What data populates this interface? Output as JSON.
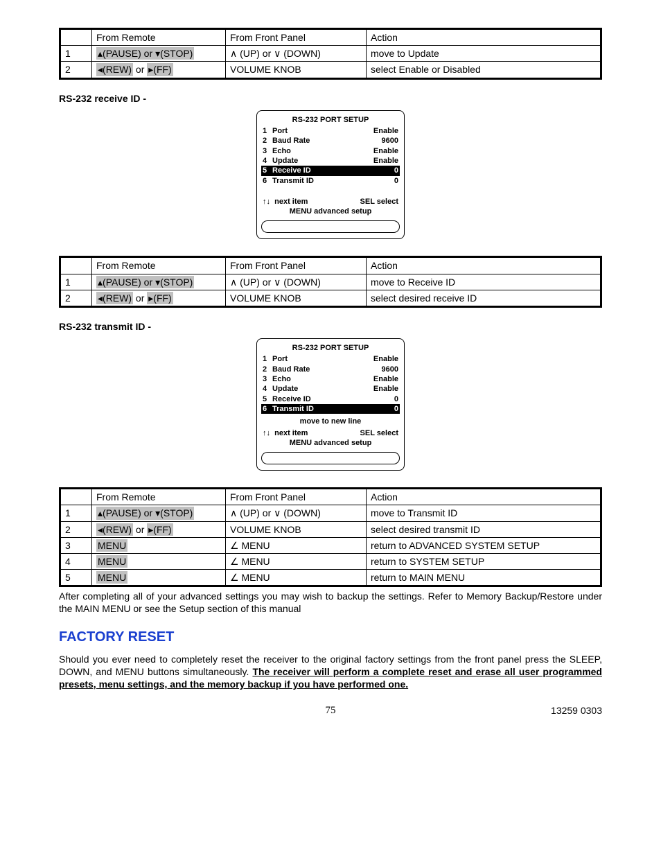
{
  "remote_segments": {
    "pause_stop_a": "▴(PAUSE) or ",
    "pause_stop_b": "▾(STOP)",
    "rew_ff_a": "◂(REW)",
    "rew_ff_mid": " or ",
    "rew_ff_b": "▸(FF)",
    "menu": "MENU"
  },
  "front_panel": {
    "up_down": "∧ (UP) or ∨ (DOWN)",
    "vol": "VOLUME KNOB",
    "menu": "∠ MENU"
  },
  "table1": {
    "headers": [
      "",
      "From Remote",
      "From Front Panel",
      "Action"
    ],
    "rows": [
      {
        "idx": "1",
        "action": "move to Update"
      },
      {
        "idx": "2",
        "action": "select Enable or Disabled"
      }
    ]
  },
  "label_receive": "RS-232 receive ID -",
  "lcd1": {
    "title": "RS-232 PORT SETUP",
    "items": [
      {
        "n": "1",
        "k": "Port",
        "v": "Enable"
      },
      {
        "n": "2",
        "k": "Baud Rate",
        "v": "9600"
      },
      {
        "n": "3",
        "k": "Echo",
        "v": "Enable"
      },
      {
        "n": "4",
        "k": "Update",
        "v": "Enable"
      },
      {
        "n": "5",
        "k": "Receive   ID",
        "v": "0",
        "hl": true
      },
      {
        "n": "6",
        "k": "Transmit ID",
        "v": "0"
      }
    ],
    "hint_next_sym": "↑↓",
    "hint_next": "next item",
    "hint_sel": "SEL  select",
    "hint_menu": "MENU  advanced setup"
  },
  "table2": {
    "headers": [
      "",
      "From Remote",
      "From Front Panel",
      "Action"
    ],
    "rows": [
      {
        "idx": "1",
        "action": "move to Receive ID"
      },
      {
        "idx": "2",
        "action": "select desired receive ID"
      }
    ]
  },
  "label_transmit": "RS-232 transmit ID -",
  "lcd2": {
    "title": "RS-232 PORT SETUP",
    "items": [
      {
        "n": "1",
        "k": "Port",
        "v": "Enable"
      },
      {
        "n": "2",
        "k": "Baud Rate",
        "v": "9600"
      },
      {
        "n": "3",
        "k": "Echo",
        "v": "Enable"
      },
      {
        "n": "4",
        "k": "Update",
        "v": "Enable"
      },
      {
        "n": "5",
        "k": "Receive   ID",
        "v": "0"
      },
      {
        "n": "6",
        "k": "Transmit ID",
        "v": "0",
        "hl": true
      }
    ],
    "move_line": "move to new line",
    "hint_next_sym": "↑↓",
    "hint_next": "next item",
    "hint_sel": "SEL  select",
    "hint_menu": "MENU  advanced  setup"
  },
  "table3": {
    "headers": [
      "",
      "From Remote",
      "From Front Panel",
      "Action"
    ],
    "rows": [
      {
        "idx": "1",
        "action": "move to Transmit ID"
      },
      {
        "idx": "2",
        "action": "select desired transmit ID"
      },
      {
        "idx": "3",
        "action": "return to ADVANCED SYSTEM SETUP"
      },
      {
        "idx": "4",
        "action": "return to SYSTEM SETUP"
      },
      {
        "idx": "5",
        "action": "return to MAIN MENU"
      }
    ]
  },
  "after_para": "After completing all of your advanced settings you may wish to backup the settings. Refer to Memory Backup/Restore under the MAIN MENU or see the Setup section of this manual",
  "section_title": "FACTORY RESET",
  "reset_para_1": "Should you ever need to completely reset the receiver to the original factory settings from the front panel press the SLEEP, DOWN, and MENU buttons simultaneously. ",
  "reset_para_2": "The receiver will perform a complete reset and erase all user programmed presets, menu settings, and the memory backup if you have performed one.",
  "footer": {
    "page": "75",
    "doc": "13259 0303"
  }
}
